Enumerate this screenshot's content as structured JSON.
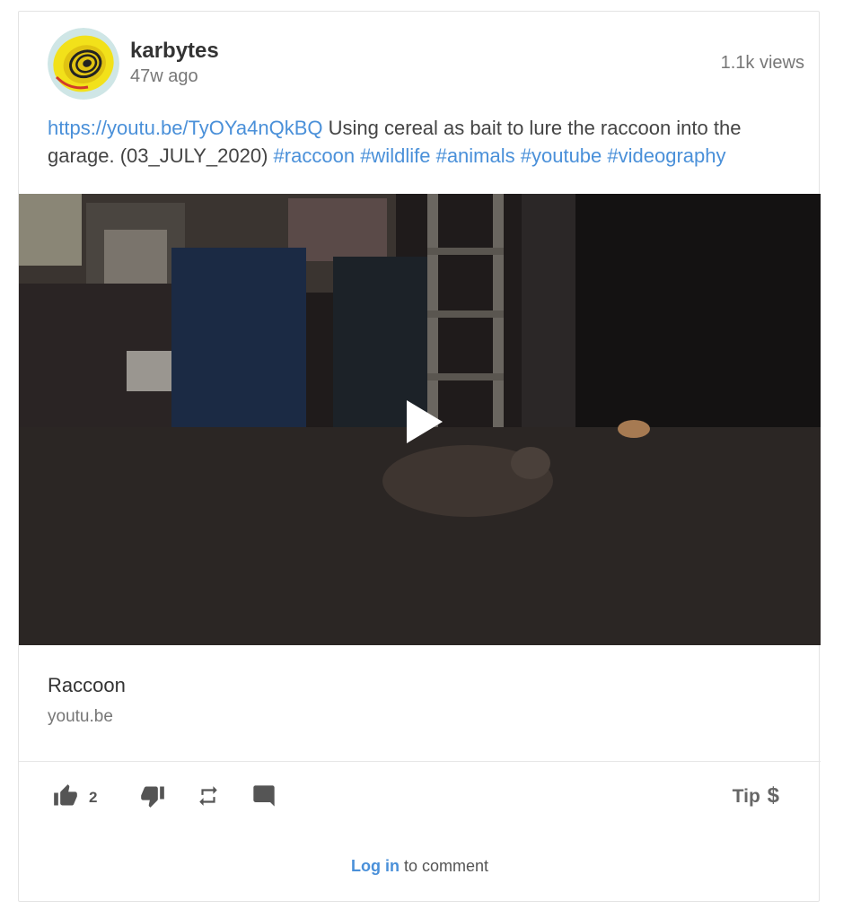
{
  "post": {
    "username": "karbytes",
    "time_ago": "47w ago",
    "views": "1.1k views",
    "link_url": "https://youtu.be/TyOYa4nQkBQ",
    "text_body": " Using cereal as bait to lure the raccoon into the garage. (03_JULY_2020) ",
    "hashtags": [
      "#raccoon",
      "#wildlife",
      "#animals",
      "#youtube",
      "#videography"
    ]
  },
  "link_preview": {
    "title": "Raccoon",
    "domain": "youtu.be"
  },
  "actions": {
    "like_count": "2",
    "tip_label": "Tip",
    "tip_symbol": "$"
  },
  "comment": {
    "login_label": "Log in",
    "suffix": " to comment"
  },
  "icons": {
    "like": "thumb-up-icon",
    "dislike": "thumb-down-icon",
    "repost": "repost-icon",
    "comment": "comment-icon",
    "play": "play-icon"
  },
  "colors": {
    "link": "#4a90d9",
    "text": "#444444",
    "muted": "#777777"
  }
}
